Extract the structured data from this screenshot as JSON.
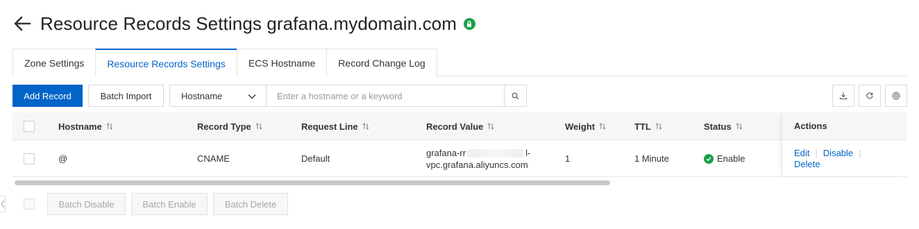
{
  "page": {
    "title": "Resource Records Settings grafana.mydomain.com",
    "back_icon": "arrow-left-icon",
    "badge_icon": "lock-badge-icon"
  },
  "tabs": [
    {
      "label": "Zone Settings",
      "active": false
    },
    {
      "label": "Resource Records Settings",
      "active": true
    },
    {
      "label": "ECS Hostname",
      "active": false
    },
    {
      "label": "Record Change Log",
      "active": false
    }
  ],
  "toolbar": {
    "add_record": "Add Record",
    "batch_import": "Batch Import",
    "search_field": "Hostname",
    "search_placeholder": "Enter a hostname or a keyword",
    "search_value": "",
    "icons": [
      "download-icon",
      "refresh-icon",
      "settings-icon"
    ]
  },
  "table": {
    "columns": [
      "Hostname",
      "Record Type",
      "Request Line",
      "Record Value",
      "Weight",
      "TTL",
      "Status",
      "Actions"
    ],
    "rows": [
      {
        "hostname": "@",
        "record_type": "CNAME",
        "request_line": "Default",
        "record_value_line1_start": "grafana-rr",
        "record_value_line1_end": "l-",
        "record_value_line2": "vpc.grafana.aliyuncs.com",
        "weight": "1",
        "ttl": "1 Minute",
        "status": "Enable",
        "actions": [
          "Edit",
          "Disable",
          "Delete"
        ]
      }
    ],
    "scroll_fraction": 0.67
  },
  "footer": {
    "batch_disable": "Batch Disable",
    "batch_enable": "Batch Enable",
    "batch_delete": "Batch Delete"
  },
  "colors": {
    "accent": "#0064c8",
    "success": "#1b9e4b"
  }
}
